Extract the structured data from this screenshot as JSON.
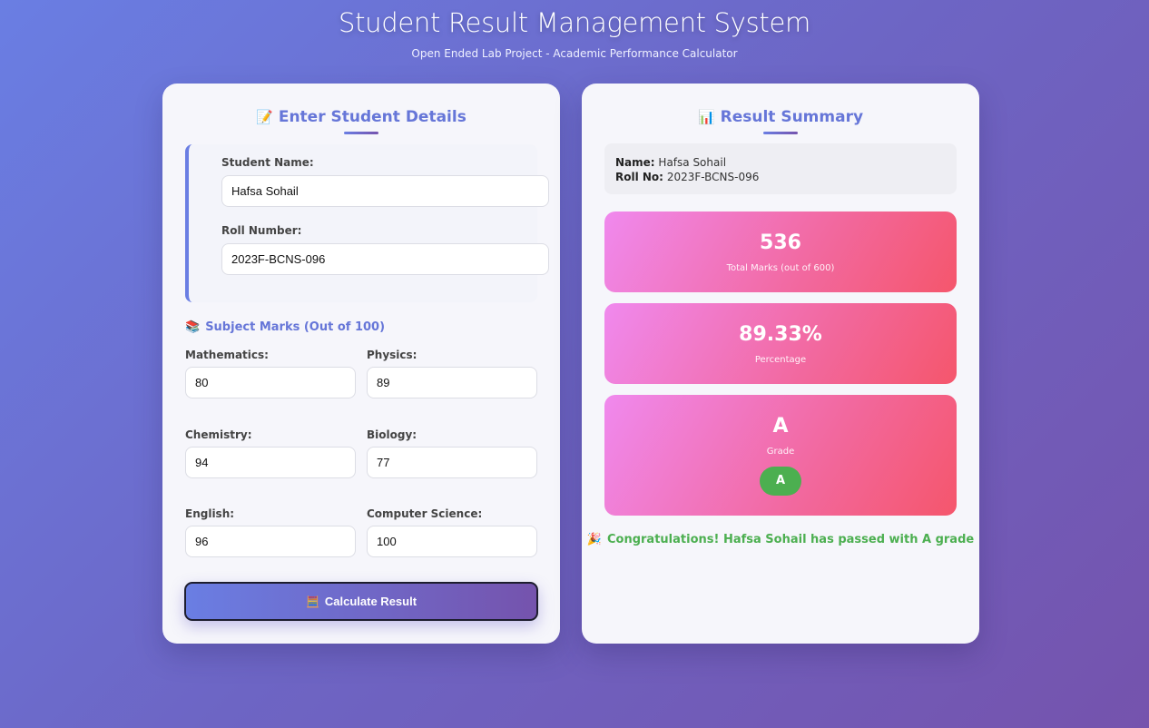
{
  "header": {
    "title": "Student Result Management System",
    "subtitle": "Open Ended Lab Project - Academic Performance Calculator"
  },
  "form": {
    "title_emoji": "📝",
    "title": "Enter Student Details",
    "student_name_label": "Student Name:",
    "student_name_value": "Hafsa Sohail",
    "roll_number_label": "Roll Number:",
    "roll_number_value": "2023F-BCNS-096",
    "subjects_emoji": "📚",
    "subjects_heading": "Subject Marks (Out of 100)",
    "subjects": [
      {
        "label": "Mathematics:",
        "value": "80"
      },
      {
        "label": "Physics:",
        "value": "89"
      },
      {
        "label": "Chemistry:",
        "value": "94"
      },
      {
        "label": "Biology:",
        "value": "77"
      },
      {
        "label": "English:",
        "value": "96"
      },
      {
        "label": "Computer Science:",
        "value": "100"
      }
    ],
    "calculate_emoji": "🧮",
    "calculate_label": "Calculate Result"
  },
  "summary": {
    "title_emoji": "📊",
    "title": "Result Summary",
    "name_label": "Name:",
    "name_value": "Hafsa Sohail",
    "roll_label": "Roll No:",
    "roll_value": "2023F-BCNS-096",
    "total_value": "536",
    "total_caption": "Total Marks (out of 600)",
    "percentage_value": "89.33%",
    "percentage_caption": "Percentage",
    "grade_value": "A",
    "grade_caption": "Grade",
    "grade_badge": "A",
    "congrats_emoji": "🎉",
    "congrats_text": "Congratulations! Hafsa Sohail has passed with A grade"
  },
  "colors": {
    "accent": "#6676d8",
    "pass_green": "#4caf50",
    "card_pink": "#f2689e"
  }
}
